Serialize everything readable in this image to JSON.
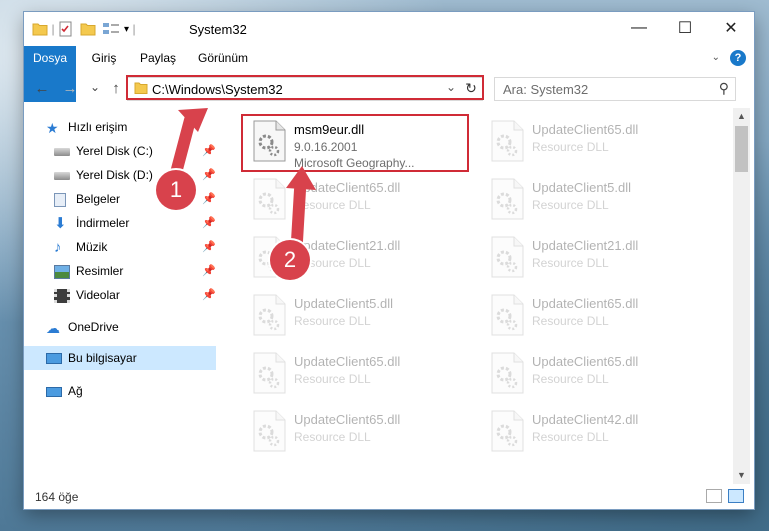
{
  "window": {
    "title": "System32",
    "controls": {
      "minimize": "—",
      "maximize": "☐",
      "close": "✕"
    }
  },
  "ribbon": {
    "tabs": [
      "Dosya",
      "Giriş",
      "Paylaş",
      "Görünüm"
    ],
    "help": "?"
  },
  "navigation": {
    "back": "←",
    "forward": "→",
    "recent": "⌄",
    "up": "↑",
    "address": "C:\\Windows\\System32",
    "search_placeholder": "Ara: System32"
  },
  "sidebar": {
    "quick_access": "Hızlı erişim",
    "pinned": [
      {
        "label": "Yerel Disk (C:)",
        "icon": "drive-icon"
      },
      {
        "label": "Yerel Disk (D:)",
        "icon": "drive-icon"
      },
      {
        "label": "Belgeler",
        "icon": "documents-icon"
      },
      {
        "label": "İndirmeler",
        "icon": "downloads-icon"
      },
      {
        "label": "Müzik",
        "icon": "music-icon"
      },
      {
        "label": "Resimler",
        "icon": "pictures-icon"
      },
      {
        "label": "Videolar",
        "icon": "videos-icon"
      }
    ],
    "onedrive": "OneDrive",
    "this_pc": "Bu bilgisayar",
    "network": "Ağ"
  },
  "files": [
    {
      "name": "msm9eur.dll",
      "line2": "9.0.16.2001",
      "line3": "Microsoft Geography...",
      "faded": false
    },
    {
      "name": "UpdateClient65.dll",
      "line2": "Resource DLL",
      "faded": true
    },
    {
      "name": "UpdateClient65.dll",
      "line2": "Resource DLL",
      "faded": true
    },
    {
      "name": "UpdateClient5.dll",
      "line2": "Resource DLL",
      "faded": true
    },
    {
      "name": "UpdateClient21.dll",
      "line2": "Resource DLL",
      "faded": true
    },
    {
      "name": "UpdateClient21.dll",
      "line2": "Resource DLL",
      "faded": true
    },
    {
      "name": "UpdateClient5.dll",
      "line2": "Resource DLL",
      "faded": true
    },
    {
      "name": "UpdateClient65.dll",
      "line2": "Resource DLL",
      "faded": true
    },
    {
      "name": "UpdateClient65.dll",
      "line2": "Resource DLL",
      "faded": true
    },
    {
      "name": "UpdateClient65.dll",
      "line2": "Resource DLL",
      "faded": true
    },
    {
      "name": "UpdateClient65.dll",
      "line2": "Resource DLL",
      "faded": true
    },
    {
      "name": "UpdateClient42.dll",
      "line2": "Resource DLL",
      "faded": true
    }
  ],
  "status": {
    "count": "164 öğe"
  },
  "annotations": {
    "step1": "1",
    "step2": "2",
    "color": "#d8424c"
  }
}
